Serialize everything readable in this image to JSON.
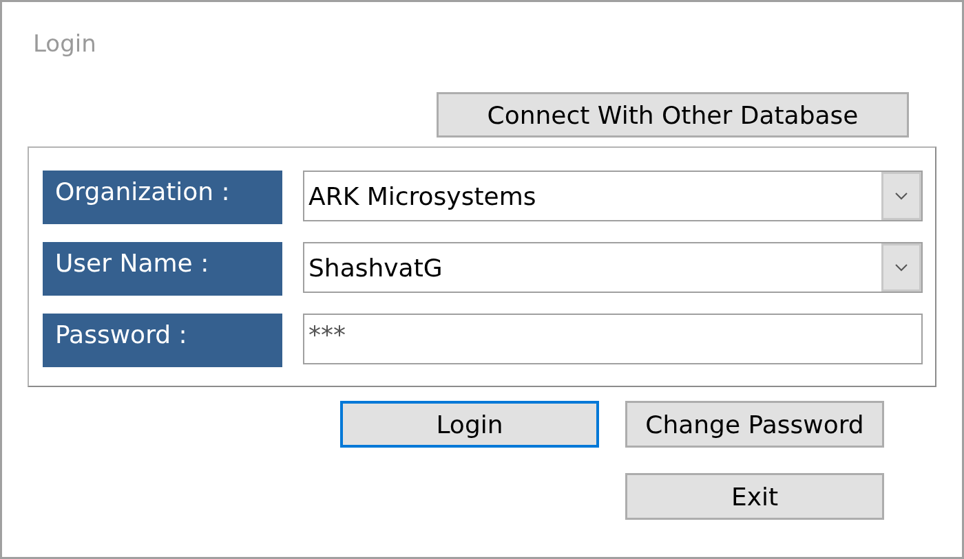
{
  "window": {
    "title": "Login"
  },
  "connect_button": "Connect With Other Database",
  "fields": [
    {
      "kind": "dropdown",
      "label": "Organization :",
      "value": "ARK Microsystems"
    },
    {
      "kind": "dropdown",
      "label": "User Name :",
      "value": "ShashvatG"
    },
    {
      "kind": "password",
      "label": "Password :",
      "value": "***"
    }
  ],
  "buttons": [
    {
      "label": "Login",
      "focused": true
    },
    {
      "label": "Change Password",
      "focused": false
    },
    {
      "label": "Exit",
      "focused": false
    }
  ]
}
